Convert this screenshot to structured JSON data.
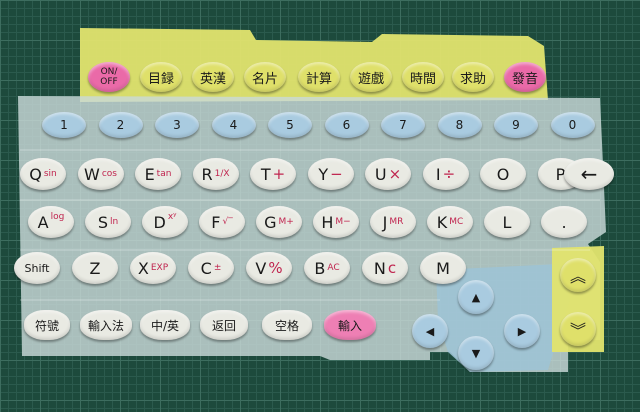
{
  "top_keys": [
    {
      "label": "ON/\nOFF",
      "color": "#ea6aa8"
    },
    {
      "label": "目録",
      "color": "#dfe06a"
    },
    {
      "label": "英漢",
      "color": "#dfe06a"
    },
    {
      "label": "名片",
      "color": "#dfe06a"
    },
    {
      "label": "計算",
      "color": "#dfe06a"
    },
    {
      "label": "遊戲",
      "color": "#dfe06a"
    },
    {
      "label": "時間",
      "color": "#dfe06a"
    },
    {
      "label": "求助",
      "color": "#dfe06a"
    },
    {
      "label": "發音",
      "color": "#ea6aa8"
    }
  ],
  "number_keys": [
    "1",
    "2",
    "3",
    "4",
    "5",
    "6",
    "7",
    "8",
    "9",
    "0"
  ],
  "row_q": [
    {
      "main": "Q",
      "sub": "sin"
    },
    {
      "main": "W",
      "sub": "cos"
    },
    {
      "main": "E",
      "sub": "tan"
    },
    {
      "main": "R",
      "sub": "1/X"
    },
    {
      "main": "T",
      "sub": "+"
    },
    {
      "main": "Y",
      "sub": "−"
    },
    {
      "main": "U",
      "sub": "×"
    },
    {
      "main": "I",
      "sub": "÷"
    },
    {
      "main": "O",
      "sub": ""
    },
    {
      "main": "P",
      "sub": ""
    }
  ],
  "backspace_glyph": "←",
  "row_a": [
    {
      "main": "A",
      "sub": "log"
    },
    {
      "main": "S",
      "sub": "ln"
    },
    {
      "main": "D",
      "sub": "xʸ"
    },
    {
      "main": "F",
      "sub": "√‾"
    },
    {
      "main": "G",
      "sub": "M+"
    },
    {
      "main": "H",
      "sub": "M−"
    },
    {
      "main": "J",
      "sub": "MR"
    },
    {
      "main": "K",
      "sub": "MC"
    },
    {
      "main": "L",
      "sub": ""
    },
    {
      "main": ".",
      "sub": ""
    }
  ],
  "row_z": [
    {
      "main": "Shift",
      "sub": ""
    },
    {
      "main": "Z",
      "sub": ""
    },
    {
      "main": "X",
      "sub": "EXP"
    },
    {
      "main": "C",
      "sub": "±"
    },
    {
      "main": "V",
      "sub": "%"
    },
    {
      "main": "B",
      "sub": "AC"
    },
    {
      "main": "N",
      "sub": "c"
    },
    {
      "main": "M",
      "sub": ""
    }
  ],
  "bottom_keys": [
    {
      "label": "符號",
      "color": "#e9eae3"
    },
    {
      "label": "輸入法",
      "color": "#e9eae3"
    },
    {
      "label": "中/英",
      "color": "#e9eae3"
    },
    {
      "label": "返回",
      "color": "#e9eae3"
    },
    {
      "label": "空格",
      "color": "#e9eae3"
    },
    {
      "label": "輸入",
      "color": "#ee7fb4"
    }
  ],
  "arrows": [
    "up",
    "left",
    "right",
    "down"
  ],
  "page_keys": [
    "page-up",
    "page-down"
  ]
}
